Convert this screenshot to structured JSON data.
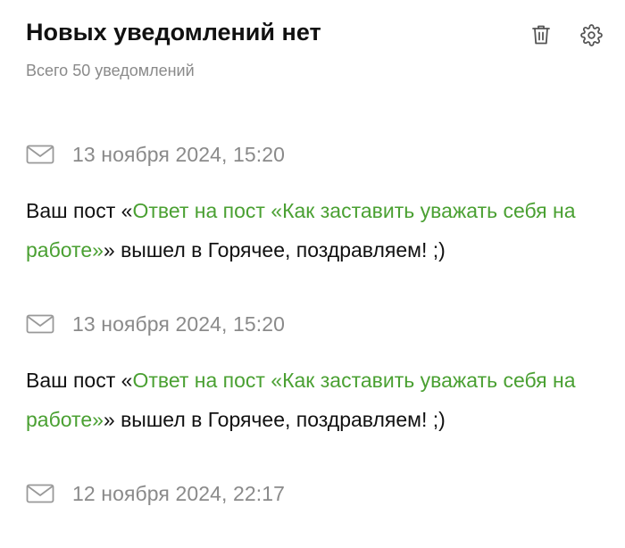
{
  "header": {
    "title": "Новых уведомлений нет",
    "subtitle": "Всего 50 уведомлений",
    "delete_icon": "trash-icon",
    "settings_icon": "gear-icon"
  },
  "colors": {
    "link": "#4aa032",
    "muted": "#8a8a8a",
    "text": "#111111"
  },
  "notifications": [
    {
      "icon": "mail-icon",
      "date": "13 ноября 2024, 15:20",
      "prefix": "Ваш пост «",
      "link": "Ответ на пост «Как заставить уважать себя на работе»",
      "suffix": "» вышел в Горячее, поздравляем! ;)"
    },
    {
      "icon": "mail-icon",
      "date": "13 ноября 2024, 15:20",
      "prefix": "Ваш пост «",
      "link": "Ответ на пост «Как заставить уважать себя на работе»",
      "suffix": "» вышел в Горячее, поздравляем! ;)"
    },
    {
      "icon": "mail-icon",
      "date": "12 ноября 2024, 22:17"
    }
  ]
}
